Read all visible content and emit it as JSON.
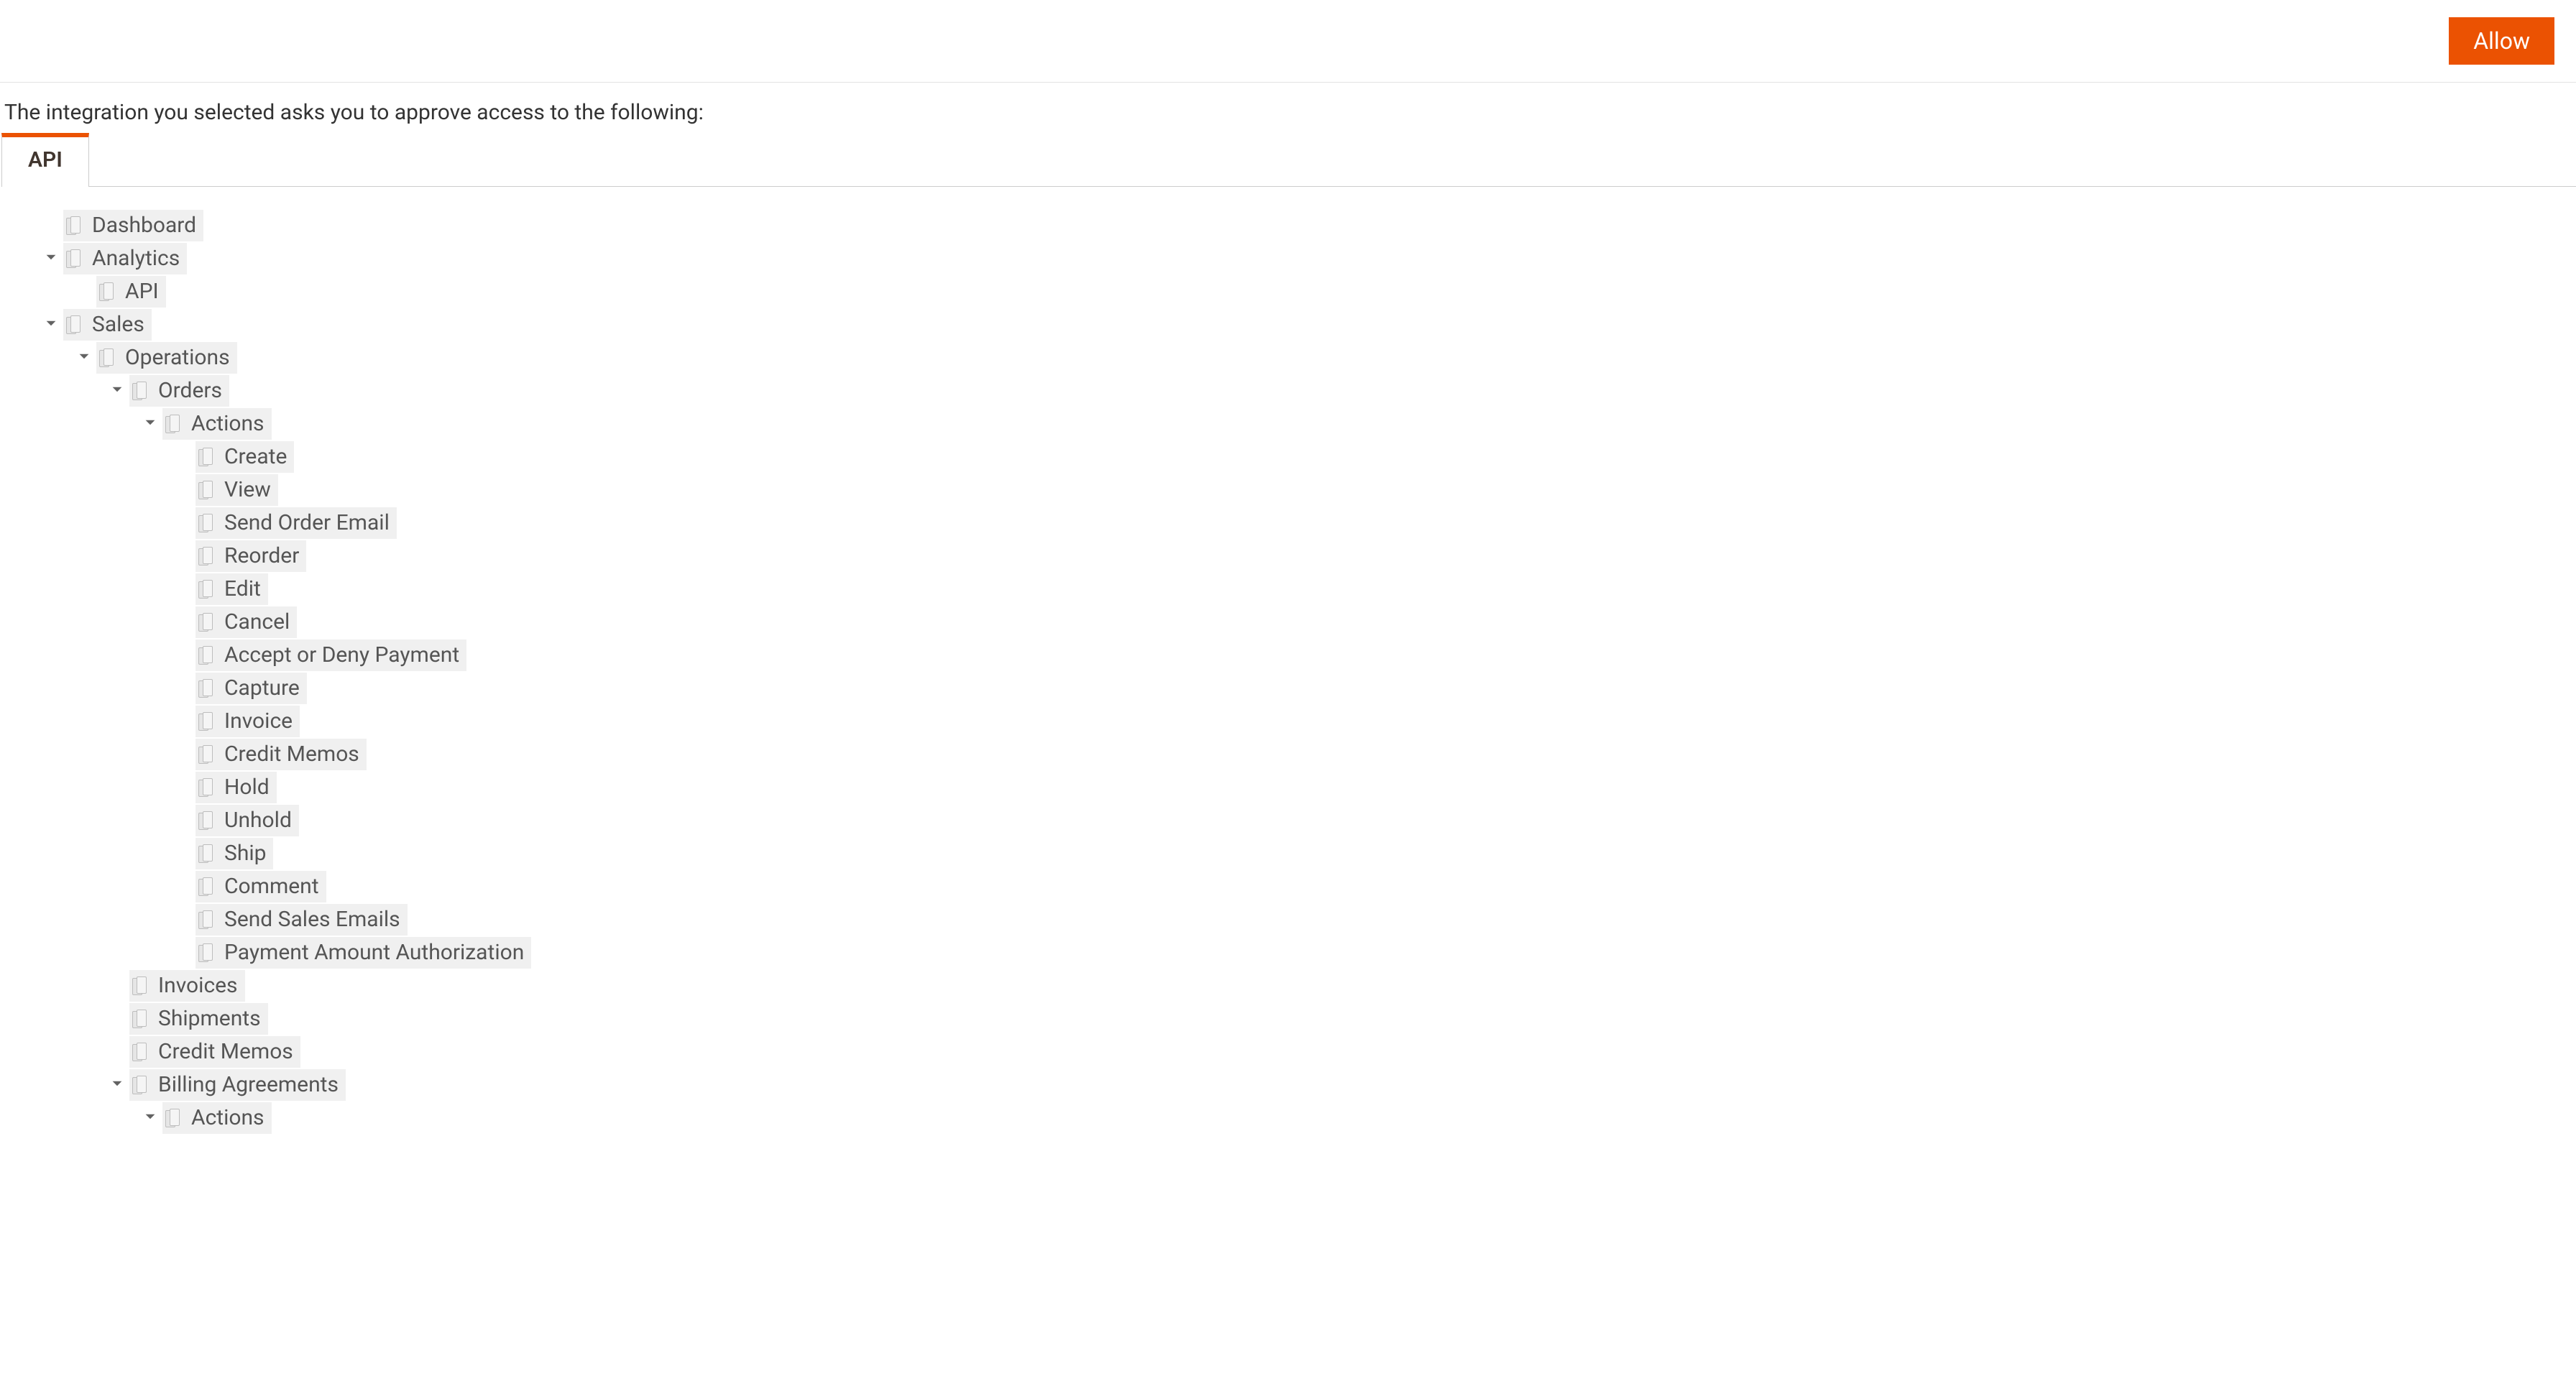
{
  "header": {
    "allow_label": "Allow"
  },
  "intro": "The integration you selected asks you to approve access to the following:",
  "tabs": {
    "api": "API"
  },
  "colors": {
    "accent": "#eb5202"
  },
  "tree": [
    {
      "label": "Dashboard"
    },
    {
      "label": "Analytics",
      "expanded": true,
      "children": [
        {
          "label": "API"
        }
      ]
    },
    {
      "label": "Sales",
      "expanded": true,
      "children": [
        {
          "label": "Operations",
          "expanded": true,
          "children": [
            {
              "label": "Orders",
              "expanded": true,
              "children": [
                {
                  "label": "Actions",
                  "expanded": true,
                  "children": [
                    {
                      "label": "Create"
                    },
                    {
                      "label": "View"
                    },
                    {
                      "label": "Send Order Email"
                    },
                    {
                      "label": "Reorder"
                    },
                    {
                      "label": "Edit"
                    },
                    {
                      "label": "Cancel"
                    },
                    {
                      "label": "Accept or Deny Payment"
                    },
                    {
                      "label": "Capture"
                    },
                    {
                      "label": "Invoice"
                    },
                    {
                      "label": "Credit Memos"
                    },
                    {
                      "label": "Hold"
                    },
                    {
                      "label": "Unhold"
                    },
                    {
                      "label": "Ship"
                    },
                    {
                      "label": "Comment"
                    },
                    {
                      "label": "Send Sales Emails"
                    },
                    {
                      "label": "Payment Amount Authorization"
                    }
                  ]
                }
              ]
            },
            {
              "label": "Invoices"
            },
            {
              "label": "Shipments"
            },
            {
              "label": "Credit Memos"
            },
            {
              "label": "Billing Agreements",
              "expanded": true,
              "children": [
                {
                  "label": "Actions",
                  "expanded": true,
                  "children": []
                }
              ]
            }
          ]
        }
      ]
    }
  ]
}
